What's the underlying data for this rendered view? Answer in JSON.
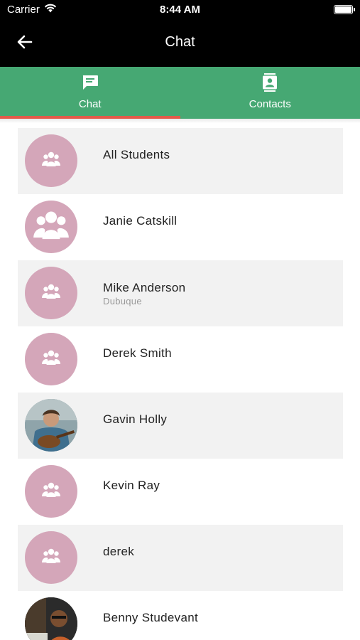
{
  "status_bar": {
    "carrier": "Carrier",
    "time": "8:44 AM",
    "battery_level": 1.0
  },
  "header": {
    "title": "Chat",
    "back_icon": "arrow-left-icon"
  },
  "tabs": [
    {
      "label": "Chat",
      "icon": "chat-bubble-icon",
      "active": true
    },
    {
      "label": "Contacts",
      "icon": "contact-card-icon",
      "active": false
    }
  ],
  "conversations": [
    {
      "name": "All Students",
      "subtitle": "",
      "avatar": "group-icon"
    },
    {
      "name": "Janie Catskill",
      "subtitle": "",
      "avatar": "group-icon"
    },
    {
      "name": "Mike Anderson",
      "subtitle": "Dubuque",
      "avatar": "group-icon"
    },
    {
      "name": "Derek Smith",
      "subtitle": "",
      "avatar": "group-icon"
    },
    {
      "name": "Gavin Holly",
      "subtitle": "",
      "avatar": "photo-guitar-player"
    },
    {
      "name": "Kevin Ray",
      "subtitle": "",
      "avatar": "group-icon"
    },
    {
      "name": "derek",
      "subtitle": "",
      "avatar": "group-icon"
    },
    {
      "name": "Benny Studevant",
      "subtitle": "",
      "avatar": "photo-pianist"
    }
  ],
  "colors": {
    "header_bg": "#000000",
    "tab_bar_bg": "#46a873",
    "tab_indicator": "#e35a4a",
    "avatar_bg": "#d4a6b9",
    "row_alt_bg": "#f2f2f2"
  }
}
